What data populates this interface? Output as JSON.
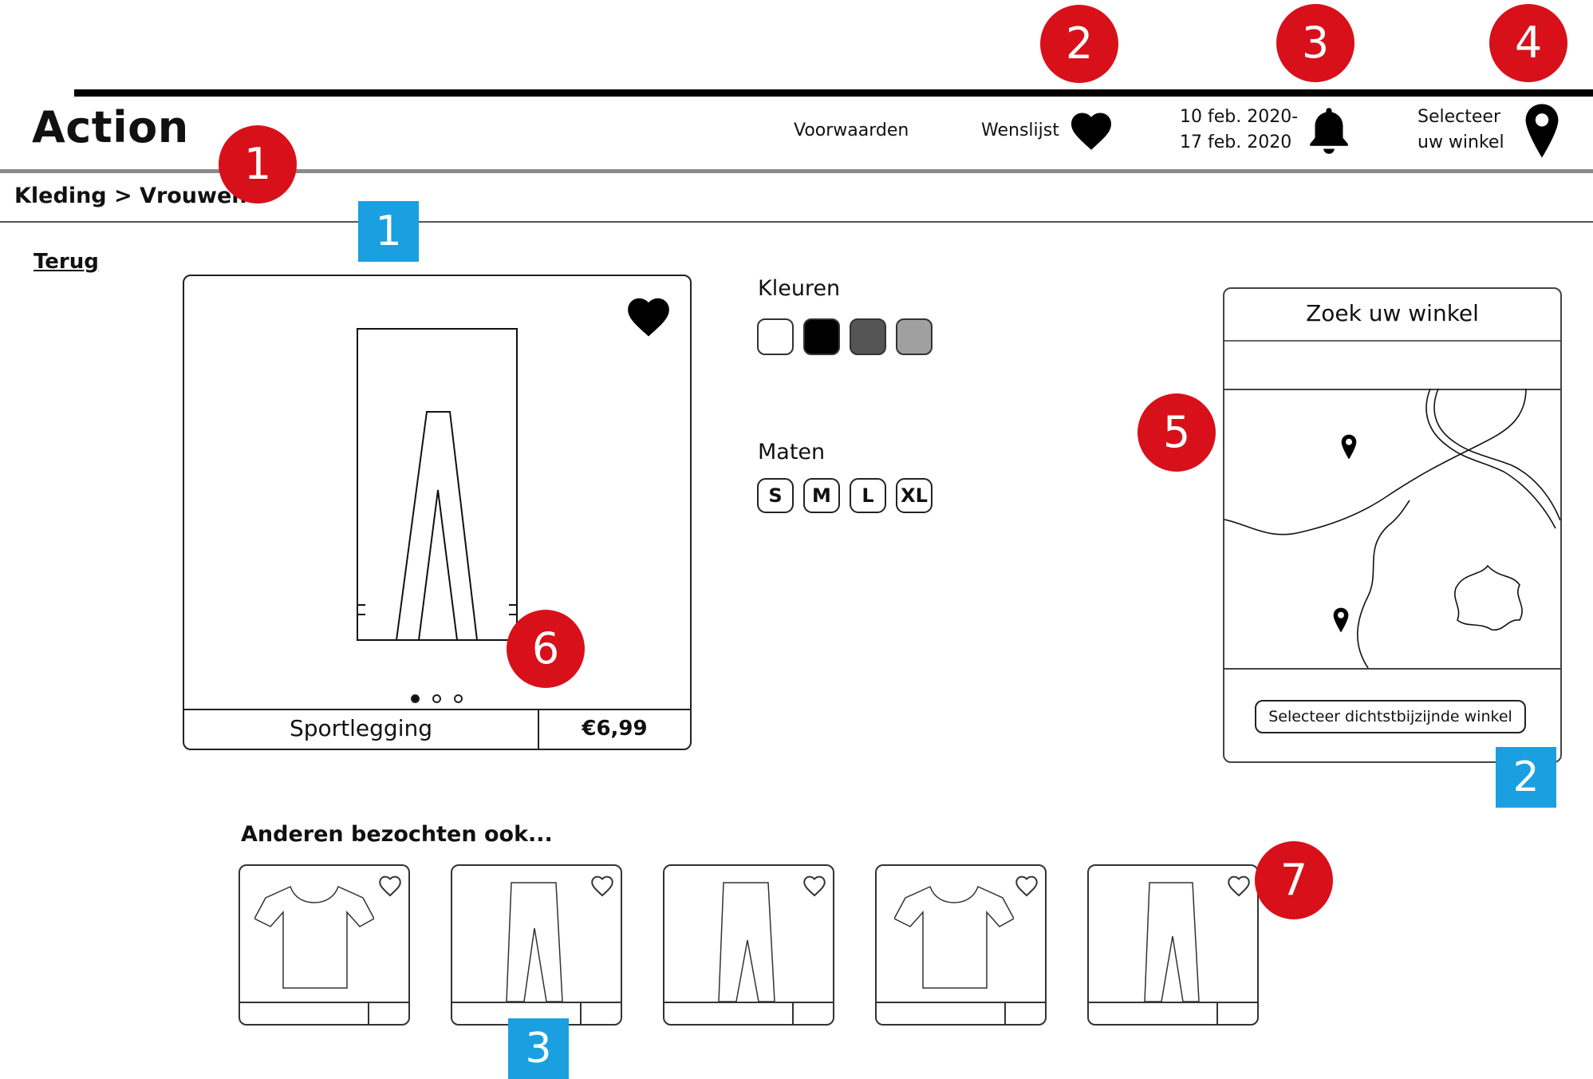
{
  "header": {
    "logo": "Action",
    "terms_label": "Voorwaarden",
    "wishlist_label": "Wenslijst",
    "date_line1": "10 feb. 2020-",
    "date_line2": "17 feb. 2020",
    "store_line1": "Selecteer",
    "store_line2": "uw winkel"
  },
  "breadcrumb": "Kleding > Vrouwen",
  "back_label": "Terug",
  "product": {
    "name": "Sportlegging",
    "price": "€6,99",
    "carousel_dots": 3,
    "active_dot": 1
  },
  "options": {
    "colors_label": "Kleuren",
    "colors": [
      "#ffffff",
      "#000000",
      "#555555",
      "#a0a0a0"
    ],
    "sizes_label": "Maten",
    "sizes": [
      "S",
      "M",
      "L",
      "XL"
    ]
  },
  "store_finder": {
    "title": "Zoek uw winkel",
    "search_value": "",
    "select_nearest_label": "Selecteer dichtstbijzijnde winkel"
  },
  "recommendations": {
    "title": "Anderen bezochten ook...",
    "items": [
      {
        "icon": "tshirt-icon"
      },
      {
        "icon": "pants-icon"
      },
      {
        "icon": "pants-icon"
      },
      {
        "icon": "tshirt-icon"
      },
      {
        "icon": "pants-icon"
      }
    ]
  },
  "annotations": {
    "red": [
      "1",
      "2",
      "3",
      "4",
      "5",
      "6",
      "7"
    ],
    "blue": [
      "1",
      "2",
      "3"
    ]
  },
  "colors": {
    "annotation_red": "#d8101a",
    "annotation_blue": "#1aa0e0"
  }
}
